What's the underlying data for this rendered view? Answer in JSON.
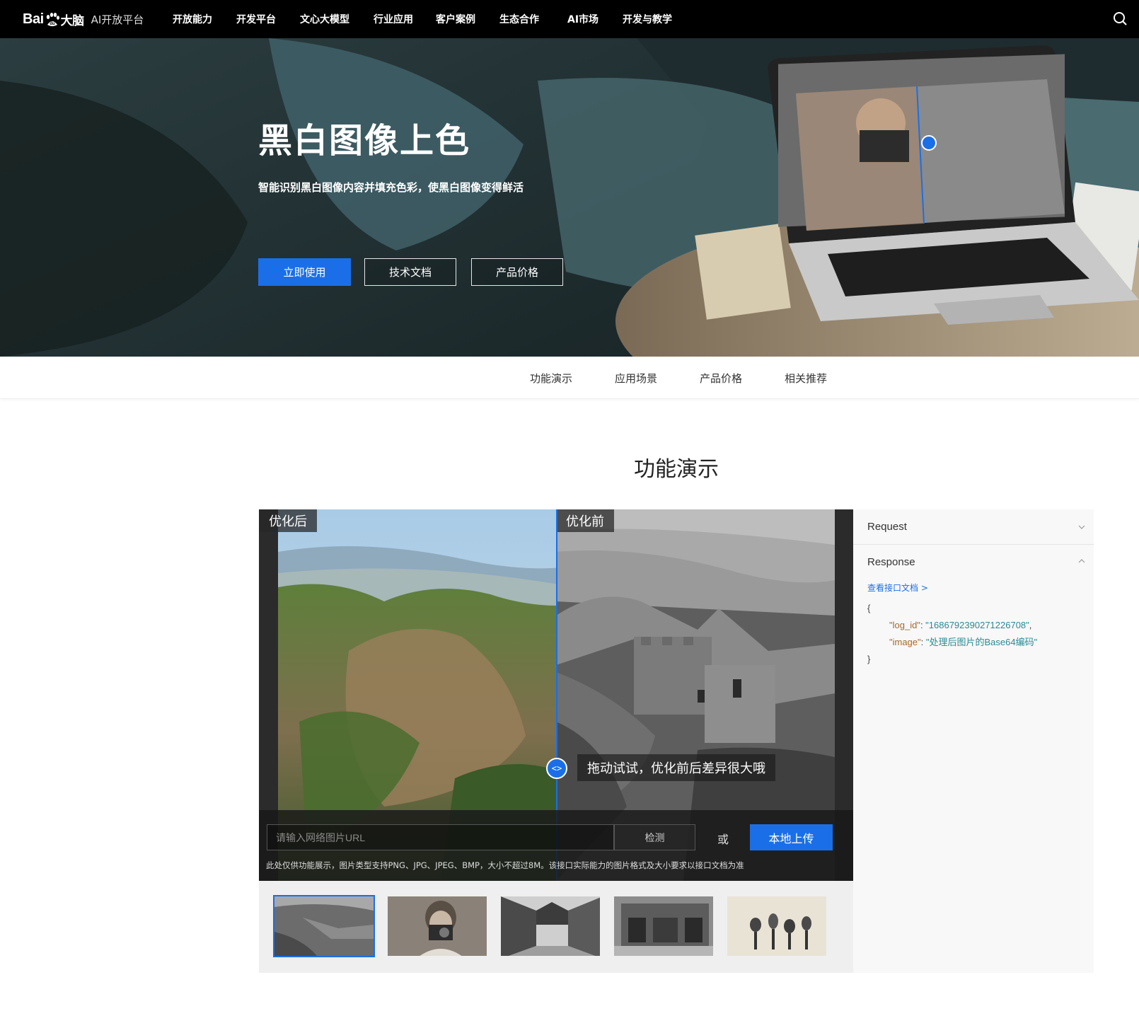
{
  "nav": {
    "logo_text": "Bai",
    "logo_text2": "大脑",
    "platform": "AI开放平台",
    "items": [
      "开放能力",
      "开发平台",
      "文心大模型",
      "行业应用",
      "客户案例",
      "生态合作",
      "AI市场",
      "开发与教学"
    ]
  },
  "hero": {
    "title": "黑白图像上色",
    "desc": "智能识别黑白图像内容并填充色彩，使黑白图像变得鲜活",
    "btn_use": "立即使用",
    "btn_doc": "技术文档",
    "btn_price": "产品价格"
  },
  "subnav": [
    "功能演示",
    "应用场景",
    "产品价格",
    "相关推荐"
  ],
  "section_title": "功能演示",
  "demo": {
    "tag_after": "优化后",
    "tag_before": "优化前",
    "hint": "拖动试试，优化前后差异很大哦",
    "handle": "<>",
    "url_placeholder": "请输入网络图片URL",
    "detect": "检测",
    "or": "或",
    "upload": "本地上传",
    "note": "此处仅供功能展示，图片类型支持PNG、JPG、JPEG、BMP，大小不超过8M。该接口实际能力的图片格式及大小要求以接口文档为准"
  },
  "thumbs": [
    {
      "name": "great-wall",
      "active": true
    },
    {
      "name": "girl-camera",
      "active": false
    },
    {
      "name": "old-street",
      "active": false
    },
    {
      "name": "storefront",
      "active": false
    },
    {
      "name": "microphones",
      "active": false
    }
  ],
  "panel": {
    "request": "Request",
    "response": "Response",
    "doc_link": "查看接口文档 >",
    "code_open": "{",
    "log_id_key": "\"log_id\"",
    "log_id_val": "\"1686792390271226708\"",
    "image_key": "\"image\"",
    "image_val": "\"处理后图片的Base64编码\"",
    "code_close": "}"
  },
  "colors": {
    "accent": "#1a6fe8",
    "nav_bg": "#000000"
  }
}
